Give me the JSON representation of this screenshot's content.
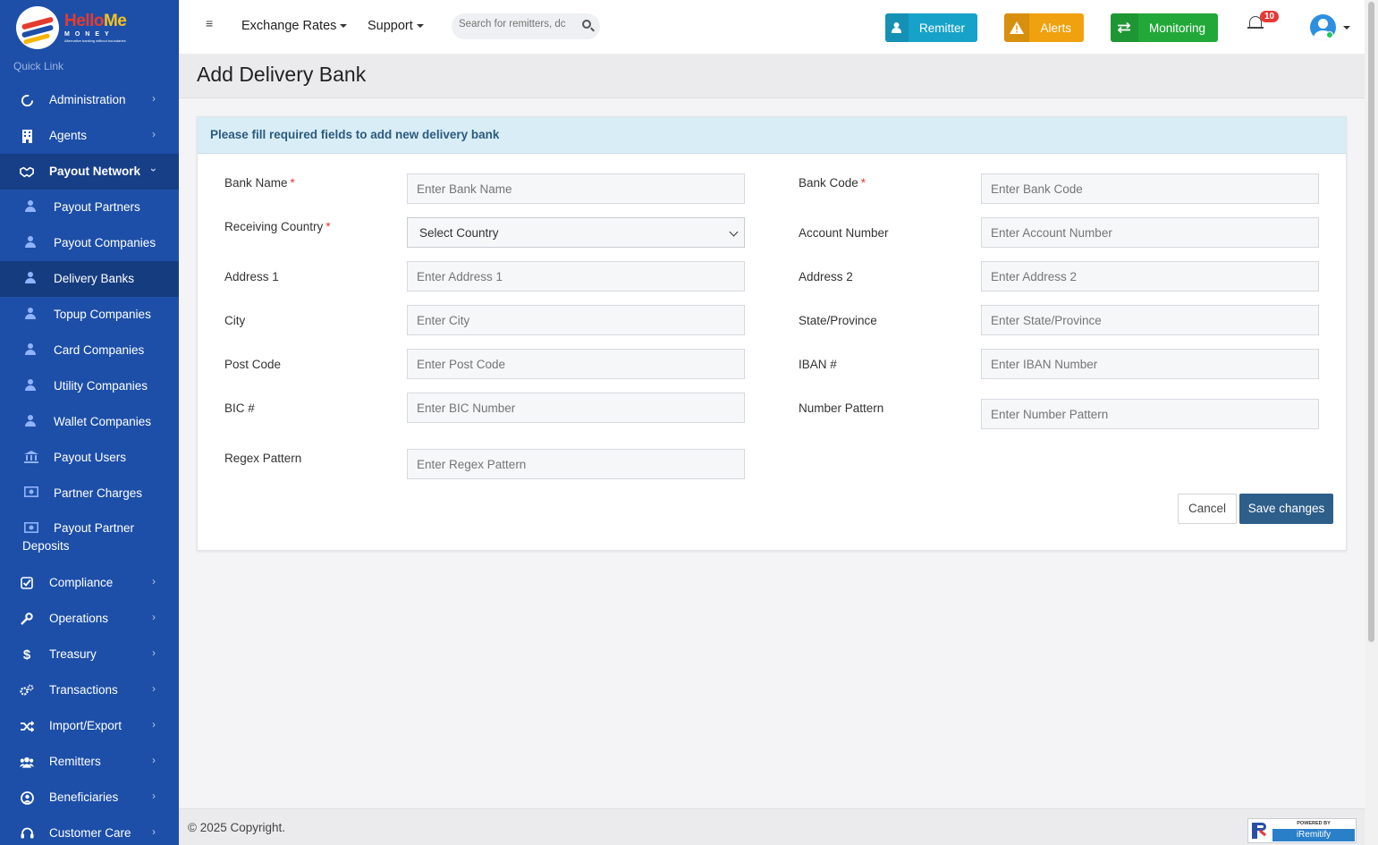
{
  "brand": {
    "name_part1": "Hello",
    "name_part2": "Me",
    "sub": "MONEY",
    "tagline": "Alternative banking without boundaries"
  },
  "sidebar": {
    "quick_link": "Quick Link",
    "items": [
      {
        "label": "Administration",
        "icon": "circle-notch-icon"
      },
      {
        "label": "Agents",
        "icon": "building-icon"
      },
      {
        "label": "Payout Network",
        "icon": "handshake-icon"
      },
      {
        "label": "Compliance",
        "icon": "check-square-icon"
      },
      {
        "label": "Operations",
        "icon": "wrench-icon"
      },
      {
        "label": "Treasury",
        "icon": "dollar-icon"
      },
      {
        "label": "Transactions",
        "icon": "cogs-icon"
      },
      {
        "label": "Import/Export",
        "icon": "random-icon"
      },
      {
        "label": "Remitters",
        "icon": "users-icon"
      },
      {
        "label": "Beneficiaries",
        "icon": "user-circle-icon"
      },
      {
        "label": "Customer Care",
        "icon": "headset-icon"
      }
    ],
    "sub_items": [
      {
        "label": "Payout Partners"
      },
      {
        "label": "Payout Companies"
      },
      {
        "label": "Delivery Banks"
      },
      {
        "label": "Topup Companies"
      },
      {
        "label": "Card Companies"
      },
      {
        "label": "Utility Companies"
      },
      {
        "label": "Wallet Companies"
      },
      {
        "label": "Payout Users"
      },
      {
        "label": "Partner Charges"
      },
      {
        "label_line1": "Payout Partner",
        "label_line2": "Deposits"
      }
    ]
  },
  "topbar": {
    "exchange_rates": "Exchange Rates",
    "support": "Support",
    "search_placeholder": "Search for remitters, dc",
    "remitter": "Remitter",
    "alerts": "Alerts",
    "monitoring": "Monitoring",
    "notification_count": "10"
  },
  "page": {
    "title": "Add Delivery Bank",
    "card_header": "Please fill required fields to add new delivery bank",
    "fields": {
      "bank_name": {
        "label": "Bank Name",
        "placeholder": "Enter Bank Name"
      },
      "bank_code": {
        "label": "Bank Code",
        "placeholder": "Enter Bank Code"
      },
      "receiving_country": {
        "label": "Receiving Country",
        "value": "Select Country"
      },
      "account_number": {
        "label": "Account Number",
        "placeholder": "Enter Account Number"
      },
      "address1": {
        "label": "Address 1",
        "placeholder": "Enter Address 1"
      },
      "address2": {
        "label": "Address 2",
        "placeholder": "Enter Address 2"
      },
      "city": {
        "label": "City",
        "placeholder": "Enter City"
      },
      "state": {
        "label": "State/Province",
        "placeholder": "Enter State/Province"
      },
      "post_code": {
        "label": "Post Code",
        "placeholder": "Enter Post Code"
      },
      "iban": {
        "label": "IBAN #",
        "placeholder": "Enter IBAN Number"
      },
      "bic": {
        "label": "BIC #",
        "placeholder": "Enter BIC Number"
      },
      "number_pattern": {
        "label": "Number Pattern",
        "placeholder": "Enter Number Pattern"
      },
      "regex_pattern": {
        "label": "Regex Pattern",
        "placeholder": "Enter Regex Pattern"
      }
    },
    "required_mark": "*",
    "cancel": "Cancel",
    "save": "Save changes"
  },
  "footer": {
    "copyright": "© 2025 Copyright.",
    "powered_by": "POWERED BY",
    "powered_name": "iRemitify"
  }
}
